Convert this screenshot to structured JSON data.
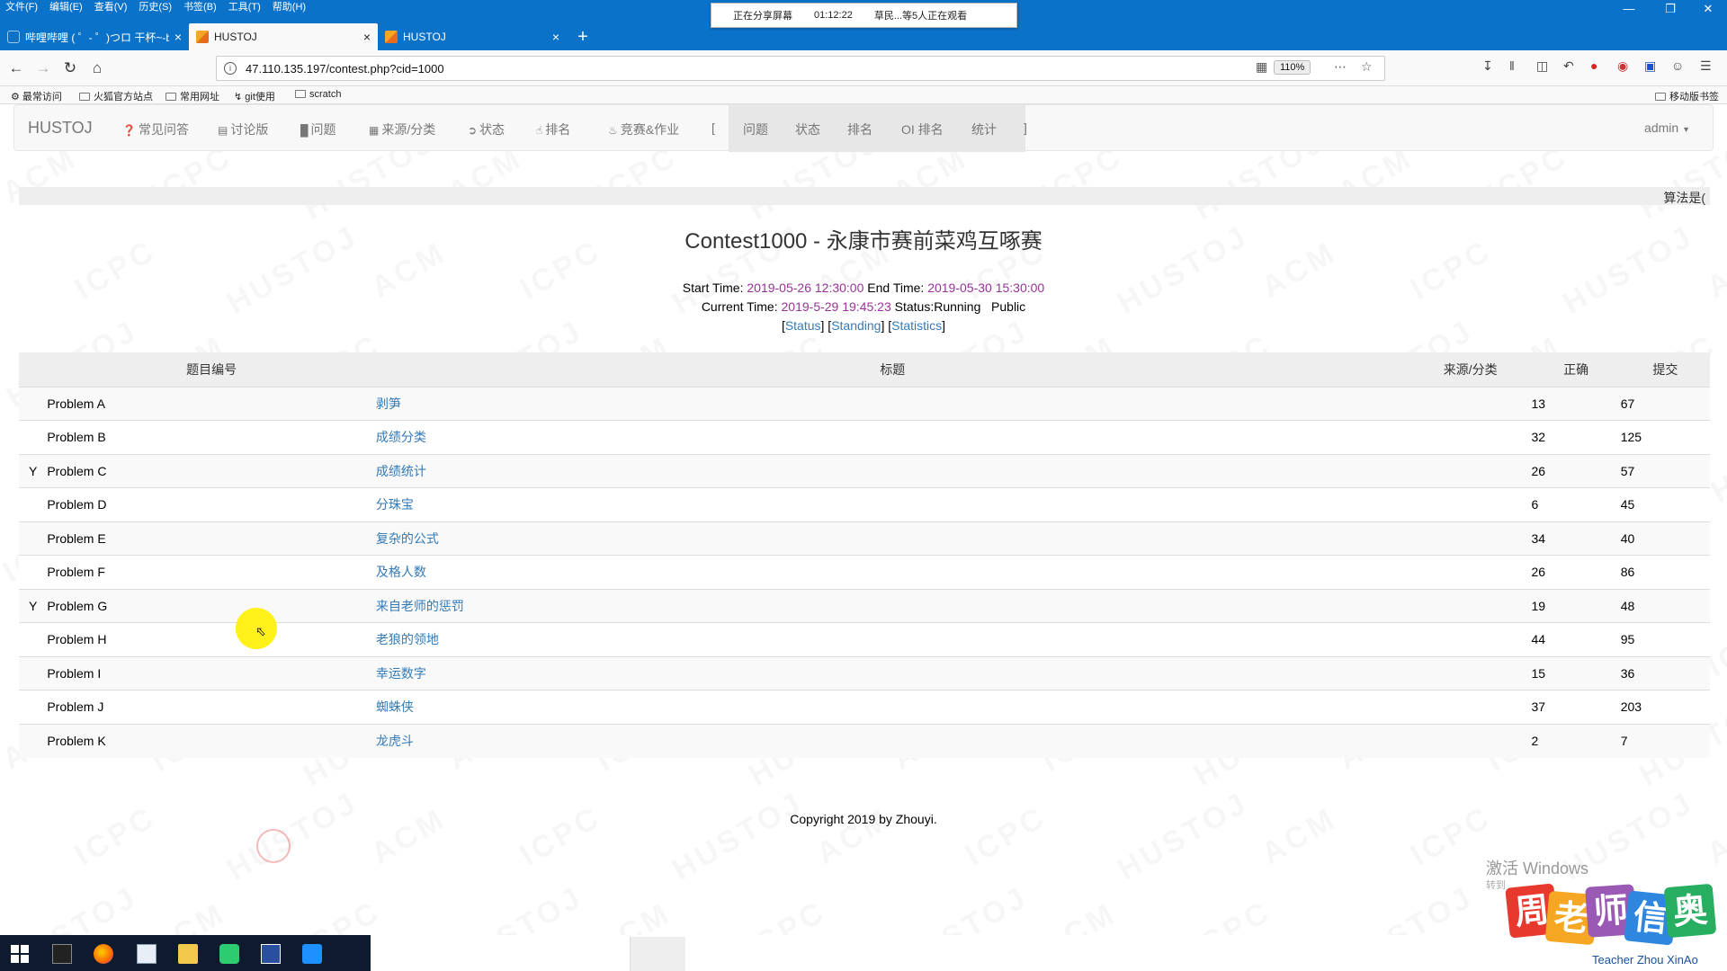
{
  "browser": {
    "menu": [
      "文件(F)",
      "编辑(E)",
      "查看(V)",
      "历史(S)",
      "书签(B)",
      "工具(T)",
      "帮助(H)"
    ],
    "tabs": [
      {
        "label": "哔哩哔哩 ( ゜- ゜)つロ 干杯~-b",
        "close": "×"
      },
      {
        "label": "HUSTOJ",
        "close": "×"
      },
      {
        "label": "HUSTOJ",
        "close": "×"
      }
    ],
    "new_tab": "+",
    "url": "47.110.135.197/contest.php?cid=1000",
    "zoom": "110%",
    "bookmarks": [
      "最常访问",
      "火狐官方站点",
      "常用网址",
      "git使用",
      "scratch"
    ],
    "mobile_bookmarks": "移动版书签"
  },
  "share_banner": {
    "status": "正在分享屏幕",
    "time": "01:12:22",
    "viewers": "草民...等5人正在观看"
  },
  "site_nav": {
    "brand": "HUSTOJ",
    "items": [
      "常见问答",
      "讨论版",
      "问题",
      "来源/分类",
      "状态",
      "排名",
      "竞赛&作业"
    ],
    "bracket_open": "[",
    "contest_items": [
      "问题",
      "状态",
      "排名",
      "OI 排名",
      "统计"
    ],
    "bracket_close": "]",
    "user": "admin"
  },
  "marquee": "算法是(",
  "contest": {
    "title": "Contest1000 - 永康市赛前菜鸡互啄赛",
    "start_label": "Start Time:",
    "start_time": "2019-05-26 12:30:00",
    "end_label": "End Time:",
    "end_time": "2019-05-30 15:30:00",
    "current_label": "Current Time:",
    "current_time": "2019-5-29 19:45:23",
    "status_label": "Status:Running",
    "visibility": "Public",
    "links": [
      "Status",
      "Standing",
      "Statistics"
    ]
  },
  "table": {
    "headers": {
      "pid": "题目编号",
      "title": "标题",
      "source": "来源/分类",
      "ac": "正确",
      "submit": "提交"
    },
    "rows": [
      {
        "flag": "",
        "pid": "Problem  A",
        "title": "剥笋",
        "source": "",
        "ac": "13",
        "submit": "67"
      },
      {
        "flag": "",
        "pid": "Problem  B",
        "title": "成绩分类",
        "source": "",
        "ac": "32",
        "submit": "125"
      },
      {
        "flag": "Y",
        "pid": "Problem  C",
        "title": "成绩统计",
        "source": "",
        "ac": "26",
        "submit": "57"
      },
      {
        "flag": "",
        "pid": "Problem  D",
        "title": "分珠宝",
        "source": "",
        "ac": "6",
        "submit": "45"
      },
      {
        "flag": "",
        "pid": "Problem  E",
        "title": "复杂的公式",
        "source": "",
        "ac": "34",
        "submit": "40"
      },
      {
        "flag": "",
        "pid": "Problem  F",
        "title": "及格人数",
        "source": "",
        "ac": "26",
        "submit": "86"
      },
      {
        "flag": "Y",
        "pid": "Problem  G",
        "title": "来自老师的惩罚",
        "source": "",
        "ac": "19",
        "submit": "48"
      },
      {
        "flag": "",
        "pid": "Problem  H",
        "title": "老狼的领地",
        "source": "",
        "ac": "44",
        "submit": "95"
      },
      {
        "flag": "",
        "pid": "Problem  I",
        "title": "幸运数字",
        "source": "",
        "ac": "15",
        "submit": "36"
      },
      {
        "flag": "",
        "pid": "Problem  J",
        "title": "蜘蛛侠",
        "source": "",
        "ac": "37",
        "submit": "203"
      },
      {
        "flag": "",
        "pid": "Problem  K",
        "title": "龙虎斗",
        "source": "",
        "ac": "2",
        "submit": "7"
      }
    ]
  },
  "footer": "Copyright 2019 by Zhouyi.",
  "activate_windows": "激活 Windows",
  "activate_sub": "转到",
  "logo": {
    "chars": [
      "周",
      "老",
      "师",
      "信",
      "奥"
    ],
    "colors": [
      "#e8392f",
      "#f5a623",
      "#9b59b6",
      "#2e86de",
      "#27ae60"
    ],
    "caption": "Teacher Zhou XinAo"
  },
  "watermark": [
    "ACM",
    "ICPC",
    "HUSTOJ"
  ]
}
